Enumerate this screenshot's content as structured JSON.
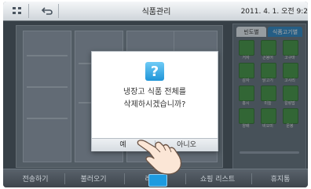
{
  "topbar": {
    "title": "식품관리",
    "datetime": "2011. 4. 1. 오전 9:2"
  },
  "right_panel": {
    "tabs": [
      "빈도별",
      "식품고기별"
    ],
    "items": [
      "거자",
      "곤봉어",
      "고구마",
      "감자",
      "닭고기",
      "고사리",
      "홍시",
      "미늘",
      "칼랑밥",
      "양배",
      "비오미",
      "문봉"
    ]
  },
  "dialog": {
    "message_line1": "냉장고 식품 전체를",
    "message_line2": "삭제하시겠습니까?",
    "yes_label": "예",
    "no_label": "아니오"
  },
  "bottombar": {
    "items": [
      "전송하기",
      "불러오기",
      "레시피",
      "쇼핑 리스트",
      "휴지통"
    ]
  },
  "colors": {
    "accent": "#1e9be0",
    "screen_bg": "#46505a",
    "item_green": "#3e8a3e"
  }
}
